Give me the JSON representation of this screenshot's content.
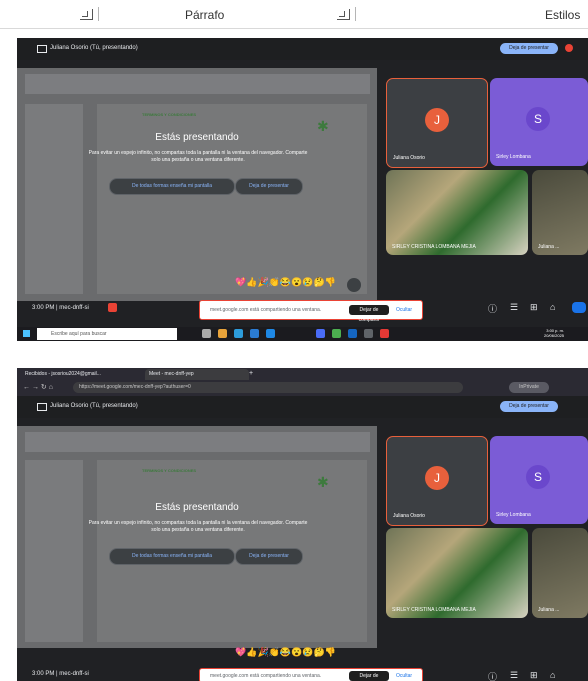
{
  "ribbon": {
    "paragraph_label": "Párrafo",
    "styles_label": "Estilos"
  },
  "meet": {
    "presenter_label": "Juliana Osorio (Tú, presentando)",
    "stop_presenting_pill": "Deja de presentar",
    "presenting_title": "Estás presentando",
    "presenting_text": "Para evitar un espejo infinito, no compartas toda la pantalla ni la ventana del navegador. Comparte solo una pestaña o una ventana diferente.",
    "share_anyway_button": "De todas formas enseña mi pantalla",
    "stop_presenting_button": "Deja de presentar",
    "slide_heading": "TERMINOS Y CONDICIONES",
    "participants": [
      {
        "name": "Juliana Osorio",
        "initial": "J",
        "color": "#e8603c"
      },
      {
        "name": "Sirley Lombana",
        "initial": "S",
        "color": "#7b5cd6"
      },
      {
        "name": "SIRLEY CRISTINA LOMBANA MEJIA"
      },
      {
        "name": "Juliana ..."
      }
    ],
    "meeting_info": "3:00 PM  |  mec-dnff-si",
    "share_notice": "meet.google.com está compartiendo una ventana.",
    "stop_sharing_button": "Dejar de compartir",
    "hide_button": "Ocultar",
    "emojis": [
      "💖",
      "👍",
      "🎉",
      "👏",
      "😂",
      "😮",
      "😢",
      "🤔",
      "👎"
    ]
  },
  "taskbar": {
    "search_placeholder": "Escribe aquí para buscar",
    "clock_time": "3:00 p. m.",
    "clock_date": "20/06/2025"
  },
  "browser": {
    "tab1_label": "Recibidos - jsosriou2024@gmail...",
    "tab2_label": "Meet - mec-dnff-yep",
    "url": "https://meet.google.com/mec-dnff-yep?authuser=0",
    "profile_label": "InPrivate"
  },
  "meet2": {
    "meeting_info": "3:00 PM  |  mec-dnff-si"
  }
}
